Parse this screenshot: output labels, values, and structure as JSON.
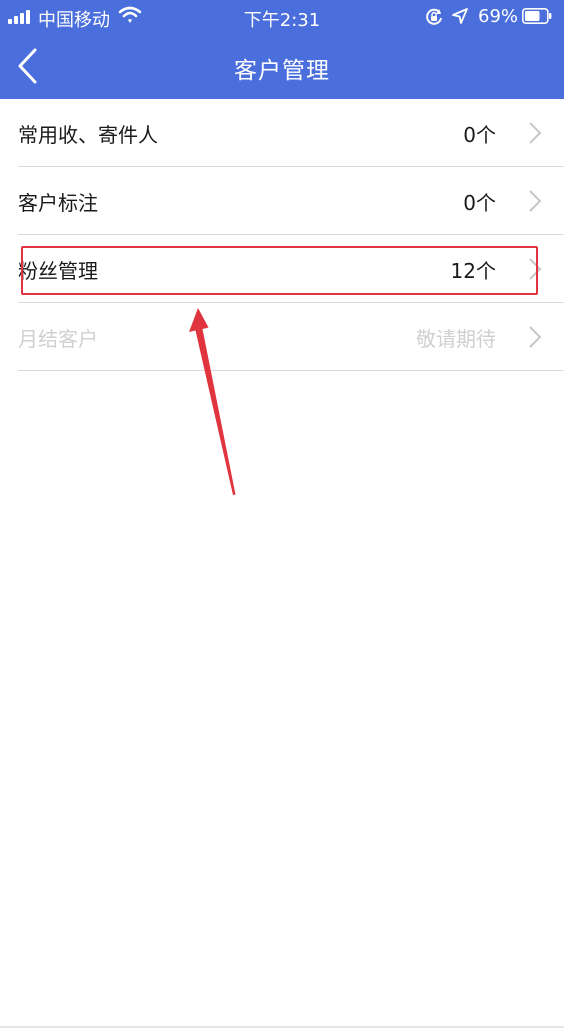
{
  "status_bar": {
    "carrier": "中国移动",
    "time": "下午2:31",
    "battery_percent": "69%",
    "battery_level": 0.69,
    "icons": [
      "signal-icon",
      "wifi-icon",
      "rotation-lock-icon",
      "location-icon",
      "battery-icon"
    ]
  },
  "nav": {
    "title": "客户管理",
    "back_icon": "chevron-left-icon"
  },
  "rows": [
    {
      "label": "常用收、寄件人",
      "value": "0个",
      "enabled": true
    },
    {
      "label": "客户标注",
      "value": "0个",
      "enabled": true
    },
    {
      "label": "粉丝管理",
      "value": "12个",
      "enabled": true
    },
    {
      "label": "月结客户",
      "value": "敬请期待",
      "enabled": false
    }
  ],
  "annotation": {
    "highlight_color": "#e0343f",
    "highlighted_row": "粉丝管理"
  },
  "colors": {
    "header": "#4a6fdc",
    "text": "#1a1a1a",
    "disabled_text": "#d0d0d0",
    "divider": "#d9d9d9"
  }
}
